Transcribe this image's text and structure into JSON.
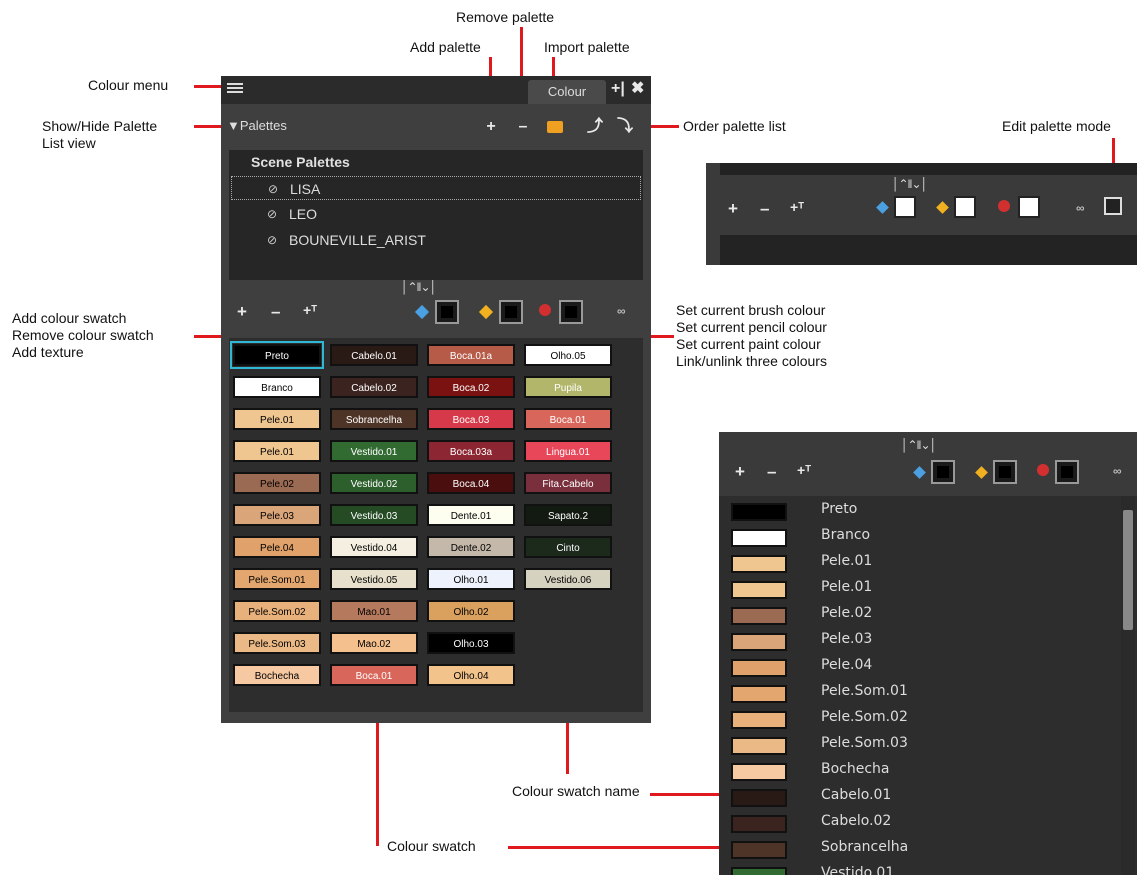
{
  "callouts": {
    "colour_menu": "Colour menu",
    "show_hide": "Show/Hide Palette\nList view",
    "add_palette": "Add palette",
    "remove_palette": "Remove palette",
    "import_palette": "Import palette",
    "order_palette": "Order palette list",
    "edit_palette_mode": "Edit palette mode",
    "add_swatch_group": "Add colour swatch\nRemove colour swatch\nAdd texture",
    "set_colours_group": "Set current brush colour\nSet current pencil colour\nSet current paint colour\nLink/unlink three colours",
    "swatch_name": "Colour swatch name",
    "swatch": "Colour swatch"
  },
  "panel": {
    "tab": "Colour",
    "palettes_toggle": "▼Palettes",
    "icons": {
      "add": "+",
      "remove": "–",
      "import": "folder-icon",
      "up": "⤴",
      "down": "⤵",
      "tab_add": "+|",
      "tab_close": "✖"
    },
    "scene_palettes_header": "Scene Palettes",
    "palettes": [
      "LISA",
      "LEO",
      "BOUNEVILLE_ARIST"
    ],
    "check": "⊘",
    "splitter": "│⌃‖⌄│",
    "swatch_tools": {
      "add": "+",
      "remove": "–",
      "texture": "+ᵀ",
      "link": "∞"
    }
  },
  "swatches": [
    {
      "name": "Preto",
      "color": "#000000",
      "text": "#ffffff",
      "col": 0,
      "row": 0,
      "selected": true
    },
    {
      "name": "Cabelo.01",
      "color": "#2a1a16",
      "text": "#ffffff",
      "col": 1,
      "row": 0
    },
    {
      "name": "Boca.01a",
      "color": "#b65b48",
      "text": "#ffffff",
      "col": 2,
      "row": 0
    },
    {
      "name": "Olho.05",
      "color": "#ffffff",
      "text": "#000000",
      "col": 3,
      "row": 0
    },
    {
      "name": "Branco",
      "color": "#ffffff",
      "text": "#000000",
      "col": 0,
      "row": 1
    },
    {
      "name": "Cabelo.02",
      "color": "#3b241f",
      "text": "#ffffff",
      "col": 1,
      "row": 1
    },
    {
      "name": "Boca.02",
      "color": "#7a1212",
      "text": "#ffffff",
      "col": 2,
      "row": 1
    },
    {
      "name": "Pupila",
      "color": "#b2b66a",
      "text": "#ffffff",
      "col": 3,
      "row": 1
    },
    {
      "name": "Pele.01",
      "color": "#f0c690",
      "text": "#000000",
      "col": 0,
      "row": 2
    },
    {
      "name": "Sobrancelha",
      "color": "#4e3427",
      "text": "#ffffff",
      "col": 1,
      "row": 2
    },
    {
      "name": "Boca.03",
      "color": "#d63a4a",
      "text": "#ffffff",
      "col": 2,
      "row": 2
    },
    {
      "name": "Boca.01",
      "color": "#d9665a",
      "text": "#ffffff",
      "col": 3,
      "row": 2
    },
    {
      "name": "Pele.01",
      "color": "#f0c690",
      "text": "#000000",
      "col": 0,
      "row": 3
    },
    {
      "name": "Vestido.01",
      "color": "#326b32",
      "text": "#ffffff",
      "col": 1,
      "row": 3
    },
    {
      "name": "Boca.03a",
      "color": "#8c2632",
      "text": "#ffffff",
      "col": 2,
      "row": 3
    },
    {
      "name": "Lingua.01",
      "color": "#e8475a",
      "text": "#ffffff",
      "col": 3,
      "row": 3
    },
    {
      "name": "Pele.02",
      "color": "#9a6a52",
      "text": "#000000",
      "col": 0,
      "row": 4
    },
    {
      "name": "Vestido.02",
      "color": "#2d5f2d",
      "text": "#ffffff",
      "col": 1,
      "row": 4
    },
    {
      "name": "Boca.04",
      "color": "#4a0e0e",
      "text": "#ffffff",
      "col": 2,
      "row": 4
    },
    {
      "name": "Fita.Cabelo",
      "color": "#7a2f3c",
      "text": "#ffffff",
      "col": 3,
      "row": 4
    },
    {
      "name": "Pele.03",
      "color": "#dba57a",
      "text": "#000000",
      "col": 0,
      "row": 5
    },
    {
      "name": "Vestido.03",
      "color": "#244b24",
      "text": "#ffffff",
      "col": 1,
      "row": 5
    },
    {
      "name": "Dente.01",
      "color": "#fdfdf0",
      "text": "#000000",
      "col": 2,
      "row": 5
    },
    {
      "name": "Sapato.2",
      "color": "#121a12",
      "text": "#ffffff",
      "col": 3,
      "row": 5
    },
    {
      "name": "Pele.04",
      "color": "#e0a26a",
      "text": "#000000",
      "col": 0,
      "row": 6
    },
    {
      "name": "Vestido.04",
      "color": "#f4efe0",
      "text": "#000000",
      "col": 1,
      "row": 6
    },
    {
      "name": "Dente.02",
      "color": "#c4b8aa",
      "text": "#000000",
      "col": 2,
      "row": 6
    },
    {
      "name": "Cinto",
      "color": "#1c2a1c",
      "text": "#ffffff",
      "col": 3,
      "row": 6
    },
    {
      "name": "Pele.Som.01",
      "color": "#e2a66e",
      "text": "#000000",
      "col": 0,
      "row": 7
    },
    {
      "name": "Vestido.05",
      "color": "#e6e0cc",
      "text": "#000000",
      "col": 1,
      "row": 7
    },
    {
      "name": "Olho.01",
      "color": "#eef2fc",
      "text": "#000000",
      "col": 2,
      "row": 7
    },
    {
      "name": "Vestido.06",
      "color": "#d6d2c0",
      "text": "#000000",
      "col": 3,
      "row": 7
    },
    {
      "name": "Pele.Som.02",
      "color": "#e8b07a",
      "text": "#000000",
      "col": 0,
      "row": 8
    },
    {
      "name": "Mao.01",
      "color": "#b57a5e",
      "text": "#000000",
      "col": 1,
      "row": 8
    },
    {
      "name": "Olho.02",
      "color": "#d9a05e",
      "text": "#000000",
      "col": 2,
      "row": 8
    },
    {
      "name": "Pele.Som.03",
      "color": "#eab985",
      "text": "#000000",
      "col": 0,
      "row": 9
    },
    {
      "name": "Mao.02",
      "color": "#f3c08e",
      "text": "#000000",
      "col": 1,
      "row": 9
    },
    {
      "name": "Olho.03",
      "color": "#000000",
      "text": "#ffffff",
      "col": 2,
      "row": 9
    },
    {
      "name": "Bochecha",
      "color": "#f7c9a2",
      "text": "#000000",
      "col": 0,
      "row": 10
    },
    {
      "name": "Boca.01",
      "color": "#d9665a",
      "text": "#ffffff",
      "col": 1,
      "row": 10
    },
    {
      "name": "Olho.04",
      "color": "#f2c48c",
      "text": "#000000",
      "col": 2,
      "row": 10
    }
  ],
  "list_view": [
    {
      "name": "Preto",
      "color": "#000000"
    },
    {
      "name": "Branco",
      "color": "#ffffff"
    },
    {
      "name": "Pele.01",
      "color": "#f0c690"
    },
    {
      "name": "Pele.01",
      "color": "#f0c690"
    },
    {
      "name": "Pele.02",
      "color": "#9a6a52"
    },
    {
      "name": "Pele.03",
      "color": "#dba57a"
    },
    {
      "name": "Pele.04",
      "color": "#e0a26a"
    },
    {
      "name": "Pele.Som.01",
      "color": "#e2a66e"
    },
    {
      "name": "Pele.Som.02",
      "color": "#e8b07a"
    },
    {
      "name": "Pele.Som.03",
      "color": "#eab985"
    },
    {
      "name": "Bochecha",
      "color": "#f7c9a2"
    },
    {
      "name": "Cabelo.01",
      "color": "#2a1a16"
    },
    {
      "name": "Cabelo.02",
      "color": "#3b241f"
    },
    {
      "name": "Sobrancelha",
      "color": "#4e3427"
    },
    {
      "name": "Vestido.01",
      "color": "#326b32"
    }
  ],
  "colors": {
    "accent_red": "#e0191f",
    "panel_bg": "#3f3f3f",
    "selection": "#2fb7d6"
  }
}
